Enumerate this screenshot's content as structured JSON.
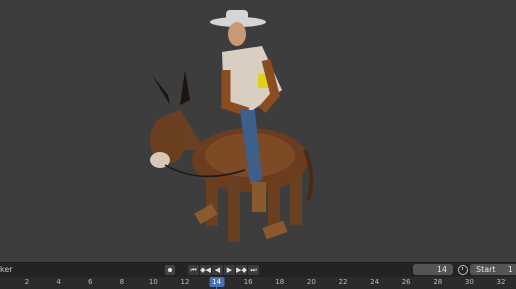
{
  "timeline": {
    "header_label": "ker",
    "current_frame": "14",
    "start_label": "Start",
    "start_value": "1",
    "transport": {
      "jump_start": "⏮",
      "prev_key": "◆◀",
      "play_reverse": "◀",
      "play": "▶",
      "next_key": "▶◆",
      "jump_end": "⏭"
    },
    "ruler_ticks": [
      "2",
      "4",
      "6",
      "8",
      "10",
      "12",
      "14",
      "16",
      "18",
      "20",
      "22",
      "24",
      "26",
      "28",
      "30",
      "32"
    ],
    "current_tick": "14"
  },
  "colors": {
    "viewport_bg": "#3d3d3d",
    "accent": "#4772b3",
    "header_bg": "#232323"
  },
  "icons": [
    "record-icon",
    "jump-start-icon",
    "prev-keyframe-icon",
    "play-reverse-icon",
    "play-icon",
    "next-keyframe-icon",
    "jump-end-icon",
    "clock-icon"
  ]
}
